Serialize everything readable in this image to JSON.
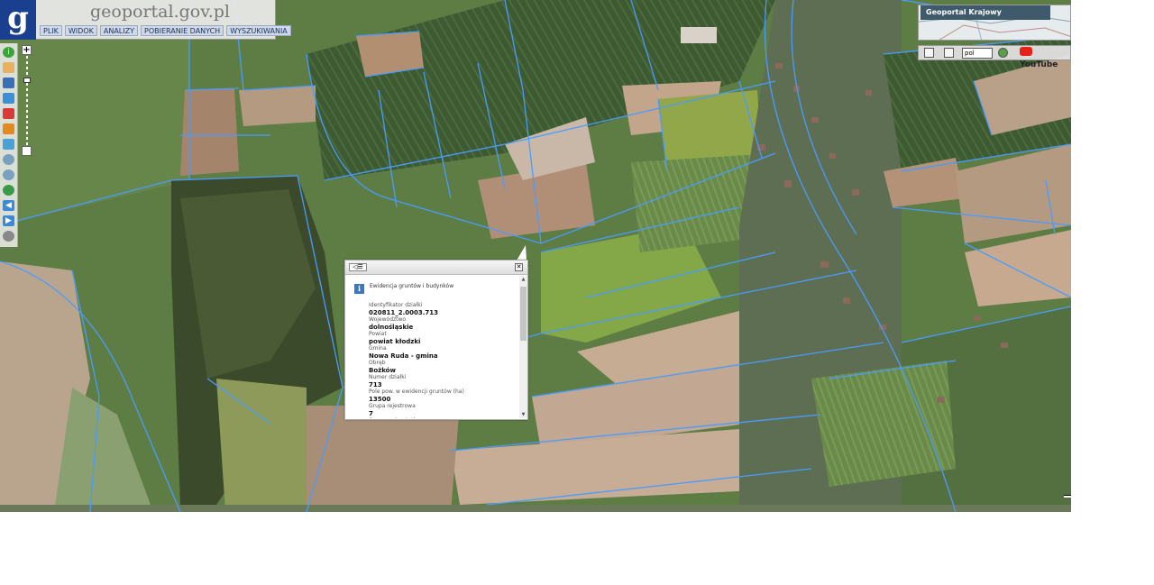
{
  "header": {
    "brand": "geoportal.gov.pl",
    "logo_letter": "g",
    "menu": [
      "PLIK",
      "WIDOK",
      "ANALIZY",
      "POBIERANIE DANYCH",
      "WYSZUKIWANIA"
    ]
  },
  "toolbar": {
    "icons": [
      "info-icon",
      "pan-icon",
      "layers-icon",
      "select-icon",
      "print-icon",
      "measure-icon",
      "scale-icon",
      "zoom-in-icon",
      "zoom-out-icon",
      "globe-icon",
      "back-icon",
      "forward-icon",
      "full-extent-icon"
    ]
  },
  "zoom": {
    "plus": "+",
    "level": 0.27
  },
  "overview": {
    "title": "Geoportal Krajowy"
  },
  "right_tools": {
    "lang": "pol",
    "youtube": "YouTube"
  },
  "popup": {
    "heading": "Ewidencja gruntów i budynków",
    "collapse_label": "◁☰",
    "close_label": "✕",
    "attributes": [
      {
        "label": "Identyfikator działki",
        "value": "020811_2.0003.713"
      },
      {
        "label": "Województwo",
        "value": "dolnośląskie"
      },
      {
        "label": "Powiat",
        "value": "powiat kłodzki"
      },
      {
        "label": "Gmina",
        "value": "Nowa Ruda - gmina"
      },
      {
        "label": "Obręb",
        "value": "Bożków"
      },
      {
        "label": "Numer działki",
        "value": "713"
      },
      {
        "label": "Pole pow. w ewidencji gruntów (ha)",
        "value": "13500"
      },
      {
        "label": "Grupa rejestrowa",
        "value": "7"
      },
      {
        "label": "Oznaczenie użytku",
        "value": ""
      }
    ]
  },
  "colors": {
    "parcel_line": "#4a9bff",
    "header_blue": "#1b3f8f"
  }
}
